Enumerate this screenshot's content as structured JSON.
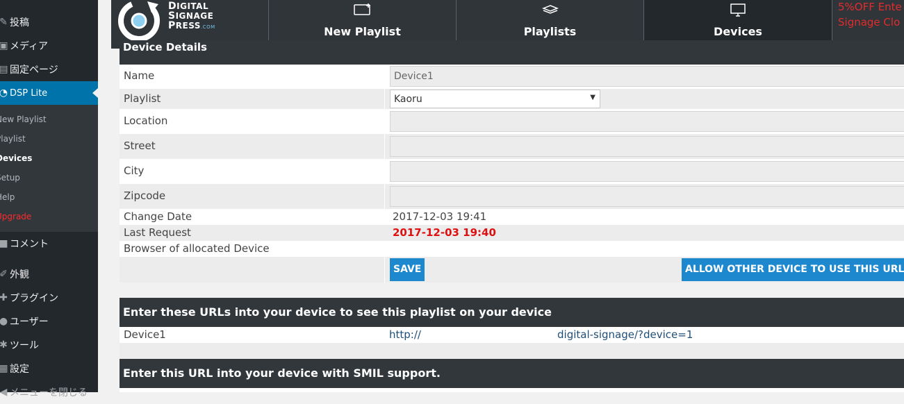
{
  "sidebar": {
    "menu_top": [
      {
        "label": "投稿",
        "icon": "pin-icon"
      },
      {
        "label": "メディア",
        "icon": "media-icon"
      },
      {
        "label": "固定ページ",
        "icon": "page-icon"
      },
      {
        "label": "DSP Lite",
        "icon": "dsp-icon"
      }
    ],
    "submenu": [
      "New Playlist",
      "Playlist",
      "Devices",
      "Setup",
      "Help",
      "Upgrade"
    ],
    "menu_bottom": [
      {
        "label": "コメント",
        "icon": "comment-icon"
      },
      {
        "label": "外観",
        "icon": "appearance-icon"
      },
      {
        "label": "プラグイン",
        "icon": "plugin-icon"
      },
      {
        "label": "ユーザー",
        "icon": "user-icon"
      },
      {
        "label": "ツール",
        "icon": "tools-icon"
      },
      {
        "label": "設定",
        "icon": "settings-icon"
      },
      {
        "label": "メニューを閉じる",
        "icon": "collapse-icon"
      }
    ]
  },
  "header": {
    "logo": {
      "line1": "IGITAL",
      "line2": "IGNAGE",
      "line3": "RESS",
      "suffix": ".COM",
      "initial1": "D",
      "initial2": "S",
      "initial3": "P"
    },
    "tabs": [
      {
        "label": "New Playlist",
        "icon": "new-playlist-icon"
      },
      {
        "label": "Playlists",
        "icon": "layers-icon"
      },
      {
        "label": "Devices",
        "icon": "monitor-icon"
      }
    ],
    "promo": [
      "5%OFF Ente",
      "Signage Clo"
    ]
  },
  "details": {
    "heading": "Device Details",
    "name_label": "Name",
    "name_value": "Device1",
    "playlist_label": "Playlist",
    "playlist_value": "Kaoru",
    "location_label": "Location",
    "street_label": "Street",
    "city_label": "City",
    "zipcode_label": "Zipcode",
    "change_date_label": "Change Date",
    "change_date_value": "2017-12-03 19:41",
    "last_request_label": "Last Request",
    "last_request_value": "2017-12-03 19:40",
    "browser_label": "Browser of allocated Device",
    "save_label": "SAVE",
    "allow_label": "ALLOW OTHER DEVICE TO USE THIS URL"
  },
  "urls": {
    "heading": "Enter these URLs into your device to see this playlist on your device",
    "device_label": "Device1",
    "url_prefix": "http://",
    "url_suffix": "digital-signage/?device=1"
  },
  "smil": {
    "heading": "Enter this URL into your device with SMIL support."
  },
  "colors": {
    "sidebar_bg": "#23282d",
    "accent": "#0073aa",
    "button": "#1e88cf",
    "header_bg": "#30353a",
    "alert_red": "#dd1111"
  }
}
